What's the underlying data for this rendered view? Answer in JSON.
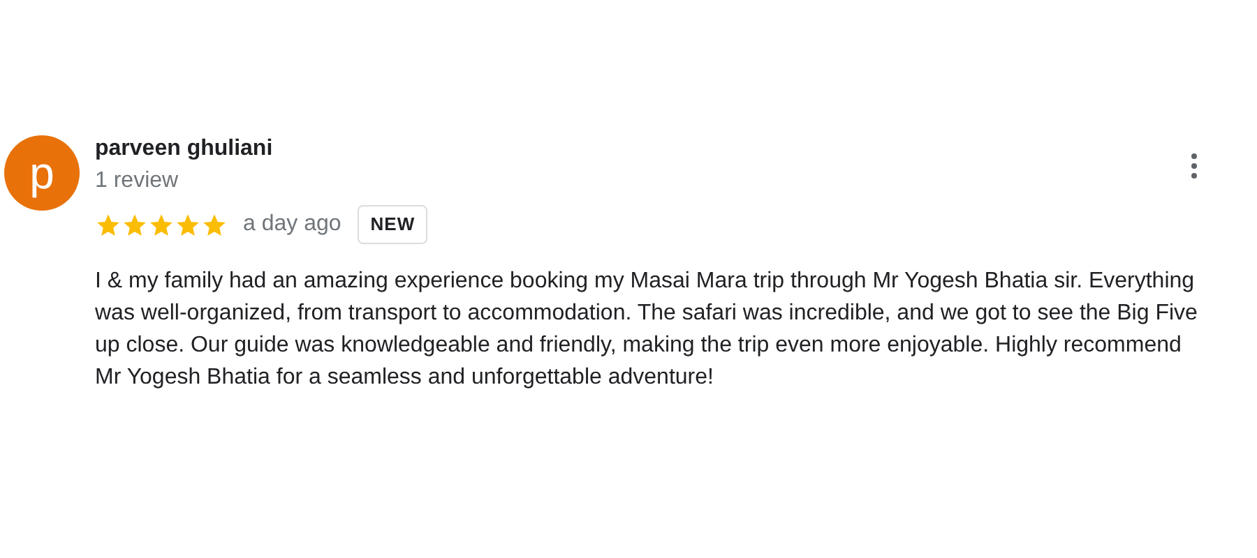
{
  "review": {
    "avatar_letter": "p",
    "author": "parveen ghuliani",
    "review_count": "1 review",
    "stars": 5,
    "time": "a day ago",
    "badge": "NEW",
    "text": "I & my family had an amazing experience booking my Masai Mara trip through Mr Yogesh Bhatia sir. Everything was well-organized, from transport to accommodation. The safari was incredible, and we got to see the Big Five up close. Our guide was knowledgeable and friendly, making the trip even more enjoyable. Highly recommend Mr Yogesh Bhatia for a seamless and unforgettable adventure!"
  }
}
